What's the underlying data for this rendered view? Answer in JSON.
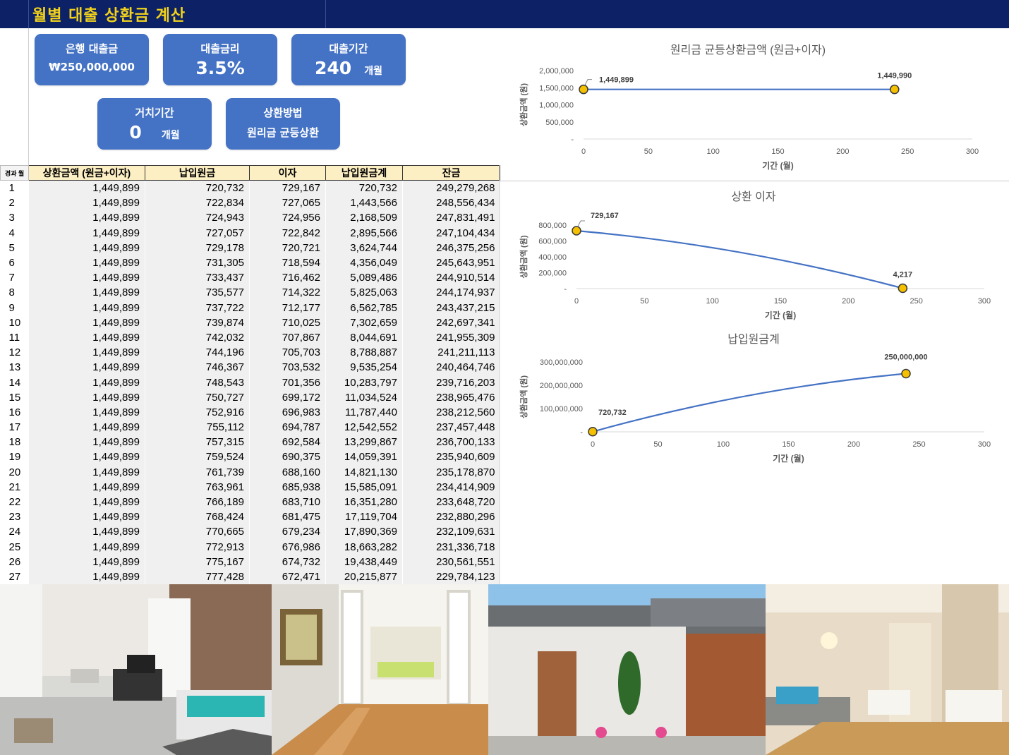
{
  "title": "월별 대출 상환금 계산",
  "cards": {
    "loan": {
      "label": "은행 대출금",
      "value": "₩250,000,000"
    },
    "rate": {
      "label": "대출금리",
      "value": "3.5%"
    },
    "term": {
      "label": "대출기간",
      "value": "240",
      "unit": "개월"
    },
    "grace": {
      "label": "거치기간",
      "value": "0",
      "unit": "개월"
    },
    "method": {
      "label": "상환방법",
      "value": "원리금 균등상환"
    }
  },
  "table": {
    "headers": [
      "경과 월",
      "상환금액 (원금+이자)",
      "납입원금",
      "이자",
      "납입원금계",
      "잔금"
    ],
    "rows": [
      [
        "1",
        "1,449,899",
        "720,732",
        "729,167",
        "720,732",
        "249,279,268"
      ],
      [
        "2",
        "1,449,899",
        "722,834",
        "727,065",
        "1,443,566",
        "248,556,434"
      ],
      [
        "3",
        "1,449,899",
        "724,943",
        "724,956",
        "2,168,509",
        "247,831,491"
      ],
      [
        "4",
        "1,449,899",
        "727,057",
        "722,842",
        "2,895,566",
        "247,104,434"
      ],
      [
        "5",
        "1,449,899",
        "729,178",
        "720,721",
        "3,624,744",
        "246,375,256"
      ],
      [
        "6",
        "1,449,899",
        "731,305",
        "718,594",
        "4,356,049",
        "245,643,951"
      ],
      [
        "7",
        "1,449,899",
        "733,437",
        "716,462",
        "5,089,486",
        "244,910,514"
      ],
      [
        "8",
        "1,449,899",
        "735,577",
        "714,322",
        "5,825,063",
        "244,174,937"
      ],
      [
        "9",
        "1,449,899",
        "737,722",
        "712,177",
        "6,562,785",
        "243,437,215"
      ],
      [
        "10",
        "1,449,899",
        "739,874",
        "710,025",
        "7,302,659",
        "242,697,341"
      ],
      [
        "11",
        "1,449,899",
        "742,032",
        "707,867",
        "8,044,691",
        "241,955,309"
      ],
      [
        "12",
        "1,449,899",
        "744,196",
        "705,703",
        "8,788,887",
        "241,211,113"
      ],
      [
        "13",
        "1,449,899",
        "746,367",
        "703,532",
        "9,535,254",
        "240,464,746"
      ],
      [
        "14",
        "1,449,899",
        "748,543",
        "701,356",
        "10,283,797",
        "239,716,203"
      ],
      [
        "15",
        "1,449,899",
        "750,727",
        "699,172",
        "11,034,524",
        "238,965,476"
      ],
      [
        "16",
        "1,449,899",
        "752,916",
        "696,983",
        "11,787,440",
        "238,212,560"
      ],
      [
        "17",
        "1,449,899",
        "755,112",
        "694,787",
        "12,542,552",
        "237,457,448"
      ],
      [
        "18",
        "1,449,899",
        "757,315",
        "692,584",
        "13,299,867",
        "236,700,133"
      ],
      [
        "19",
        "1,449,899",
        "759,524",
        "690,375",
        "14,059,391",
        "235,940,609"
      ],
      [
        "20",
        "1,449,899",
        "761,739",
        "688,160",
        "14,821,130",
        "235,178,870"
      ],
      [
        "21",
        "1,449,899",
        "763,961",
        "685,938",
        "15,585,091",
        "234,414,909"
      ],
      [
        "22",
        "1,449,899",
        "766,189",
        "683,710",
        "16,351,280",
        "233,648,720"
      ],
      [
        "23",
        "1,449,899",
        "768,424",
        "681,475",
        "17,119,704",
        "232,880,296"
      ],
      [
        "24",
        "1,449,899",
        "770,665",
        "679,234",
        "17,890,369",
        "232,109,631"
      ],
      [
        "25",
        "1,449,899",
        "772,913",
        "676,986",
        "18,663,282",
        "231,336,718"
      ],
      [
        "26",
        "1,449,899",
        "775,167",
        "674,732",
        "19,438,449",
        "230,561,551"
      ],
      [
        "27",
        "1,449,899",
        "777,428",
        "672,471",
        "20,215,877",
        "229,784,123"
      ]
    ]
  },
  "chart_data": [
    {
      "type": "line",
      "title": "원리금 균등상환금액 (원금+이자)",
      "xlabel": "기간 (월)",
      "ylabel": "상환금액 (원)",
      "xlim": [
        0,
        300
      ],
      "ylim": [
        0,
        2000000
      ],
      "x_ticks": [
        "0",
        "50",
        "100",
        "150",
        "200",
        "250",
        "300"
      ],
      "y_ticks": [
        "-",
        "500,000",
        "1,000,000",
        "1,500,000",
        "2,000,000"
      ],
      "series": [
        {
          "x": [
            0,
            240
          ],
          "y": [
            1449899,
            1449990
          ]
        }
      ],
      "data_labels": [
        "1,449,899",
        "1,449,990"
      ],
      "color": "#4472c4",
      "marker_color": "#f5c000"
    },
    {
      "type": "line",
      "title": "상환 이자",
      "xlabel": "기간 (월)",
      "ylabel": "상환금액 (원)",
      "xlim": [
        0,
        300
      ],
      "ylim": [
        0,
        800000
      ],
      "x_ticks": [
        "0",
        "50",
        "100",
        "150",
        "200",
        "250",
        "300"
      ],
      "y_ticks": [
        "-",
        "200,000",
        "400,000",
        "600,000",
        "800,000"
      ],
      "series": [
        {
          "x": [
            0,
            240
          ],
          "y": [
            729167,
            4217
          ]
        }
      ],
      "data_labels": [
        "729,167",
        "4,217"
      ],
      "color": "#4472c4",
      "marker_color": "#f5c000"
    },
    {
      "type": "line",
      "title": "납입원금계",
      "xlabel": "기간 (월)",
      "ylabel": "상환금액 (원)",
      "xlim": [
        0,
        300
      ],
      "ylim": [
        0,
        300000000
      ],
      "x_ticks": [
        "0",
        "50",
        "100",
        "150",
        "200",
        "250",
        "300"
      ],
      "y_ticks": [
        "-",
        "100,000,000",
        "200,000,000",
        "300,000,000"
      ],
      "series": [
        {
          "x": [
            0,
            240
          ],
          "y": [
            720732,
            250000000
          ]
        }
      ],
      "data_labels": [
        "720,732",
        "250,000,000"
      ],
      "color": "#4472c4",
      "marker_color": "#f5c000"
    }
  ],
  "photos": [
    {
      "icon": "bedroom-photo"
    },
    {
      "icon": "living-room-photo"
    },
    {
      "icon": "house-exterior-photo"
    },
    {
      "icon": "hotel-room-photo"
    }
  ]
}
